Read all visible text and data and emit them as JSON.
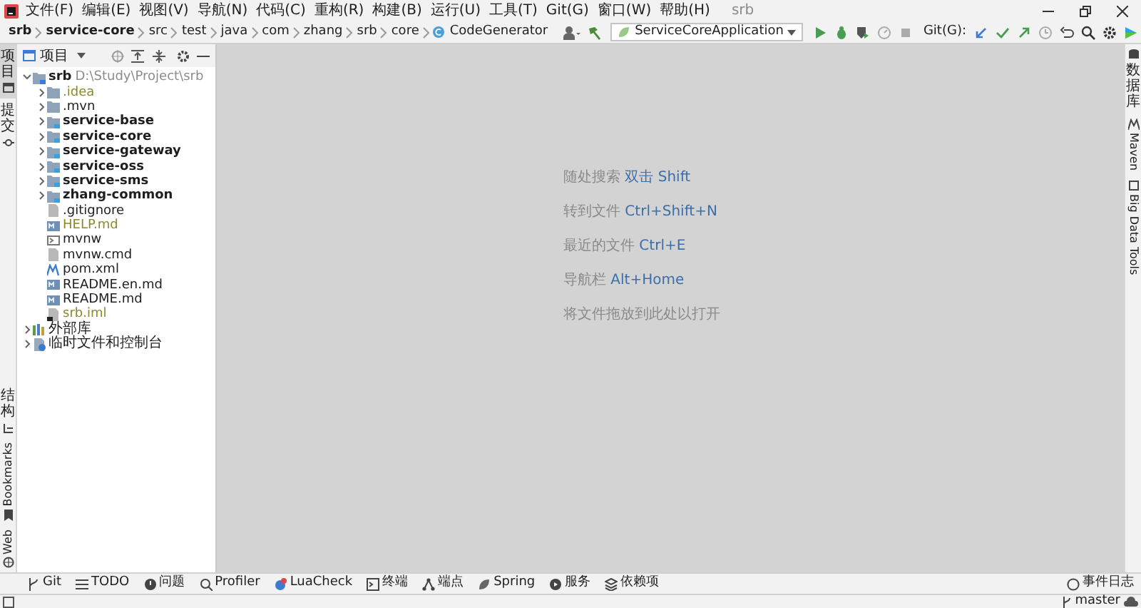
{
  "menu": [
    "文件(F)",
    "编辑(E)",
    "视图(V)",
    "导航(N)",
    "代码(C)",
    "重构(R)",
    "构建(B)",
    "运行(U)",
    "工具(T)",
    "Git(G)",
    "窗口(W)",
    "帮助(H)"
  ],
  "window": {
    "title": "srb"
  },
  "breadcrumb": [
    {
      "label": "srb",
      "bold": true
    },
    {
      "label": "service-core",
      "bold": true
    },
    {
      "label": "src",
      "bold": false
    },
    {
      "label": "test",
      "bold": false
    },
    {
      "label": "java",
      "bold": false
    },
    {
      "label": "com",
      "bold": false
    },
    {
      "label": "zhang",
      "bold": false
    },
    {
      "label": "srb",
      "bold": false
    },
    {
      "label": "core",
      "bold": false
    },
    {
      "label": "CodeGenerator",
      "bold": false
    }
  ],
  "run_config": {
    "value": "ServiceCoreApplication"
  },
  "git_label": "Git(G):",
  "left_strip": {
    "top": [
      {
        "label": "项目",
        "selected": true
      },
      {
        "label": "提交",
        "selected": false
      }
    ],
    "bottom": [
      {
        "label": "结构",
        "selected": false
      },
      {
        "label": "Bookmarks",
        "selected": false
      },
      {
        "label": "Web",
        "selected": false
      }
    ]
  },
  "right_strip": [
    {
      "label": "数据库"
    },
    {
      "label": "Maven"
    },
    {
      "label": "Big Data Tools"
    }
  ],
  "project_panel": {
    "title": "项目",
    "tree": [
      {
        "name": "srb",
        "path": "D:\\Study\\Project\\srb",
        "kind": "root",
        "expanded": true,
        "ignored": false,
        "children": [
          {
            "name": ".idea",
            "kind": "folder",
            "expanded": false,
            "ignored": true
          },
          {
            "name": ".mvn",
            "kind": "folder",
            "expanded": false,
            "ignored": false
          },
          {
            "name": "service-base",
            "kind": "module",
            "expanded": false,
            "ignored": false
          },
          {
            "name": "service-core",
            "kind": "module",
            "expanded": false,
            "ignored": false
          },
          {
            "name": "service-gateway",
            "kind": "module",
            "expanded": false,
            "ignored": false
          },
          {
            "name": "service-oss",
            "kind": "module",
            "expanded": false,
            "ignored": false
          },
          {
            "name": "service-sms",
            "kind": "module",
            "expanded": false,
            "ignored": false
          },
          {
            "name": "zhang-common",
            "kind": "module",
            "expanded": false,
            "ignored": false
          },
          {
            "name": ".gitignore",
            "kind": "text",
            "ignored": false
          },
          {
            "name": "HELP.md",
            "kind": "markdown",
            "ignored": true
          },
          {
            "name": "mvnw",
            "kind": "script",
            "ignored": false
          },
          {
            "name": "mvnw.cmd",
            "kind": "text",
            "ignored": false
          },
          {
            "name": "pom.xml",
            "kind": "maven",
            "ignored": false
          },
          {
            "name": "README.en.md",
            "kind": "markdown",
            "ignored": false
          },
          {
            "name": "README.md",
            "kind": "markdown",
            "ignored": false
          },
          {
            "name": "srb.iml",
            "kind": "iml",
            "ignored": true
          }
        ]
      },
      {
        "name": "外部库",
        "kind": "library",
        "expanded": false,
        "ignored": false
      },
      {
        "name": "临时文件和控制台",
        "kind": "scratch",
        "expanded": false,
        "ignored": false
      }
    ]
  },
  "editor_hints": [
    {
      "action": "随处搜索",
      "shortcut": "双击 Shift"
    },
    {
      "action": "转到文件",
      "shortcut": "Ctrl+Shift+N"
    },
    {
      "action": "最近的文件",
      "shortcut": "Ctrl+E"
    },
    {
      "action": "导航栏",
      "shortcut": "Alt+Home"
    },
    {
      "action": "将文件拖放到此处以打开"
    }
  ],
  "tool_windows": [
    "Git",
    "TODO",
    "问题",
    "Profiler",
    "LuaCheck",
    "终端",
    "端点",
    "Spring",
    "服务",
    "依赖项"
  ],
  "event_log": "事件日志",
  "status_bar": {
    "branch": "master"
  }
}
